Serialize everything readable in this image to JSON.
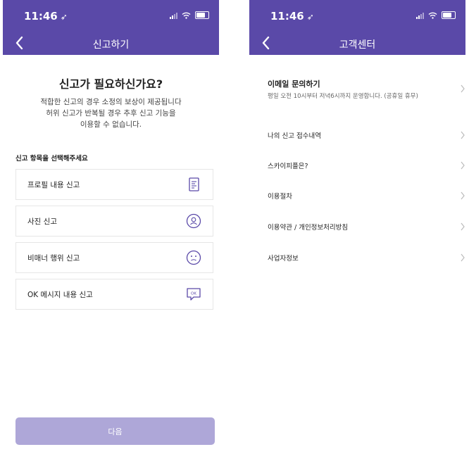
{
  "status": {
    "time": "11:46",
    "location_icon": "location-arrow-icon"
  },
  "colors": {
    "header": "#5a49a8",
    "button_disabled": "#aea7d8",
    "icon": "#5a49a8"
  },
  "report": {
    "header_title": "신고하기",
    "title": "신고가 필요하신가요?",
    "desc_lines": [
      "적합한 신고의 경우 소정의 보상이 제공됩니다",
      "허위 신고가 반복될 경우 추후 신고 기능을",
      "이용할 수 없습니다."
    ],
    "section_label": "신고 항목을 선택해주세요",
    "options": [
      {
        "label": "프로필 내용 신고",
        "icon": "document-icon"
      },
      {
        "label": "사진 신고",
        "icon": "person-icon"
      },
      {
        "label": "비매너 행위 신고",
        "icon": "sad-face-icon"
      },
      {
        "label": "OK 메시지 내용 신고",
        "icon": "ok-message-icon",
        "icon_text": "OK"
      }
    ],
    "next_label": "다음"
  },
  "support": {
    "header_title": "고객센터",
    "email": {
      "label": "이메일 문의하기",
      "sub": "평일 오전 10시부터 저녁6시까지 운영합니다. (공휴일 휴무)"
    },
    "items": [
      {
        "label": "나의 신고 접수내역"
      },
      {
        "label": "스카이피플은?"
      },
      {
        "label": "이용절차"
      },
      {
        "label": "이용약관 / 개인정보처리방침"
      },
      {
        "label": "사업자정보"
      }
    ]
  }
}
